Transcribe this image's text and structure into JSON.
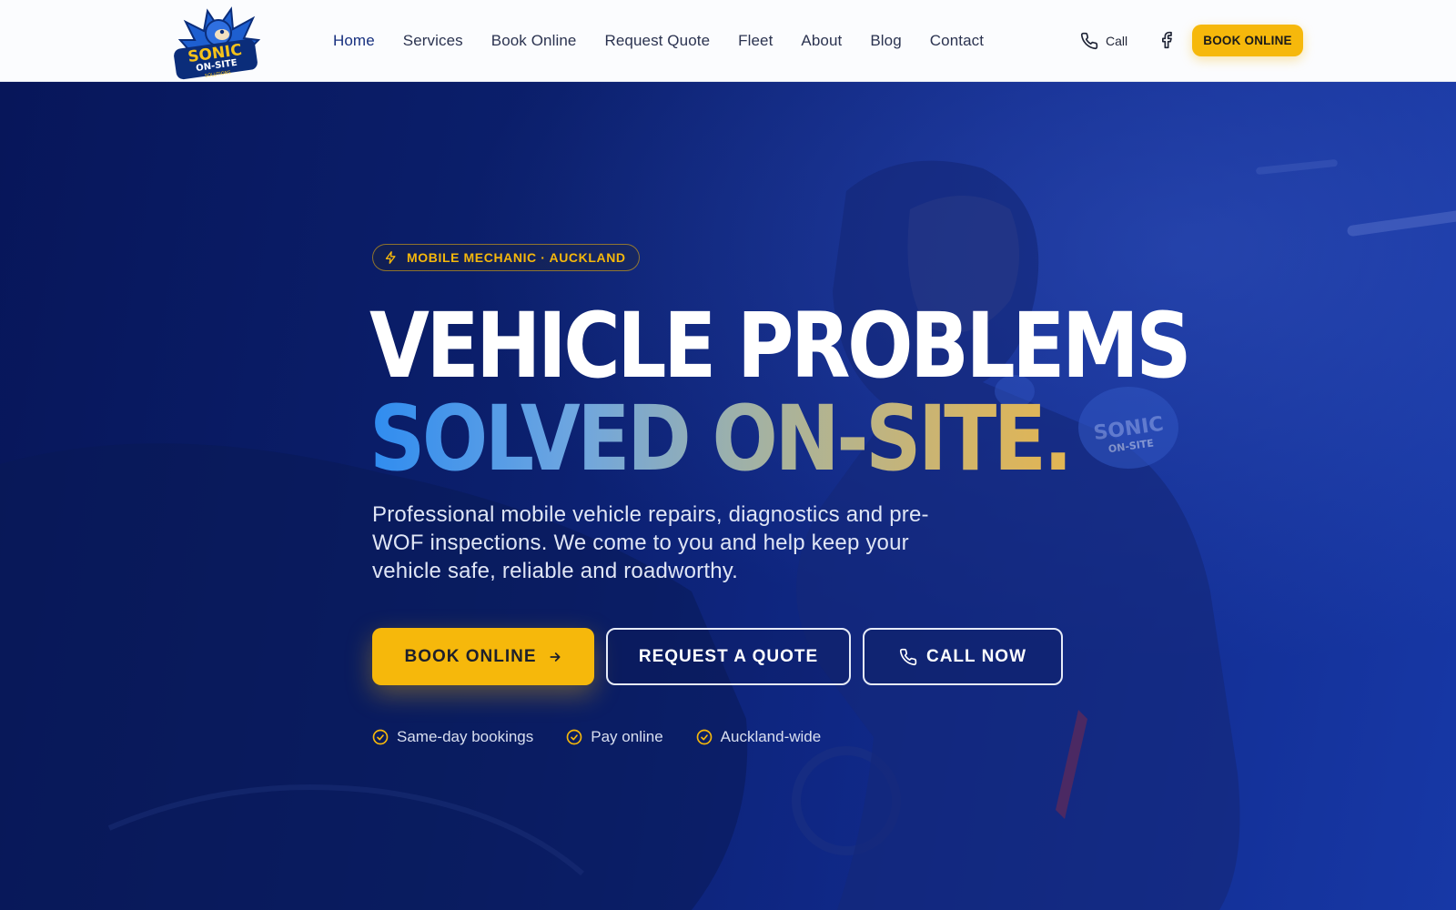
{
  "header": {
    "logo": {
      "line1": "SONIC",
      "line2": "ON-SITE",
      "line3": "SOLUTIONS"
    },
    "nav": [
      {
        "label": "Home",
        "active": true
      },
      {
        "label": "Services"
      },
      {
        "label": "Book Online"
      },
      {
        "label": "Request Quote"
      },
      {
        "label": "Fleet"
      },
      {
        "label": "About"
      },
      {
        "label": "Blog"
      },
      {
        "label": "Contact"
      }
    ],
    "call_label": "Call",
    "facebook_icon": "facebook-icon",
    "cta_label": "BOOK ONLINE"
  },
  "hero": {
    "badge": "MOBILE MECHANIC · AUCKLAND",
    "headline_line1": "VEHICLE PROBLEMS",
    "headline_line2": "SOLVED ON-SITE.",
    "subtitle": "Professional mobile vehicle repairs, diagnostics and pre-WOF inspections. We come to you and help keep your vehicle safe, reliable and roadworthy.",
    "buttons": {
      "book": "BOOK ONLINE",
      "quote": "REQUEST A QUOTE",
      "call": "CALL NOW"
    },
    "features": [
      "Same-day bookings",
      "Pay online",
      "Auckland-wide"
    ]
  },
  "colors": {
    "accent": "#f6b80b",
    "brand_blue": "#17307f",
    "hero_bg": "#0b1f6c",
    "headline_gradient_start": "#2f8cf0",
    "headline_gradient_end": "#f2b63b"
  }
}
